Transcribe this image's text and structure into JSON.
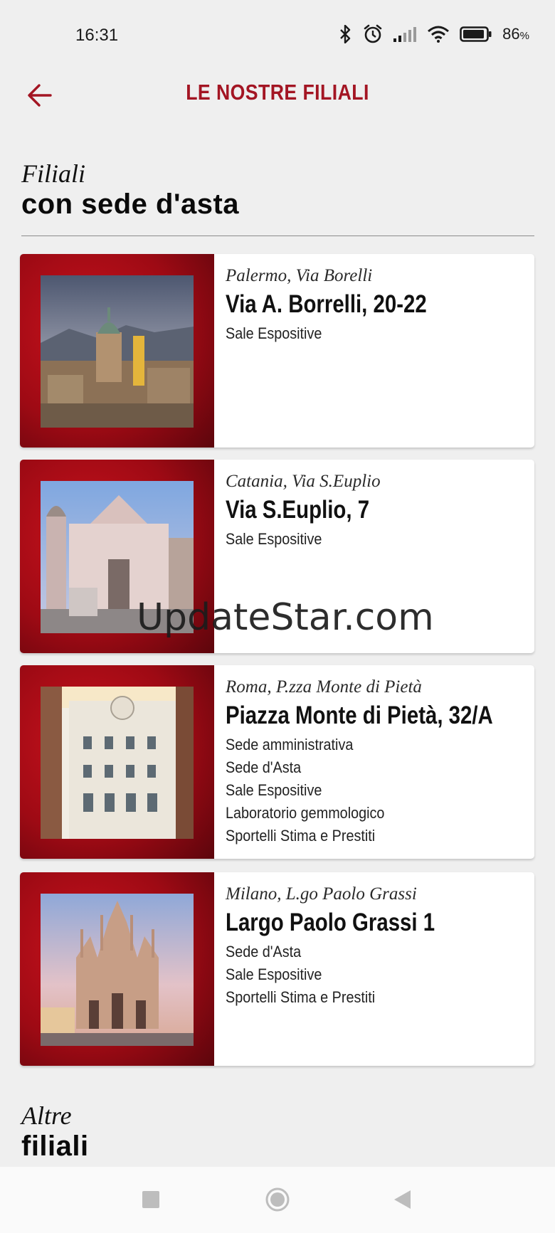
{
  "status_bar": {
    "time": "16:31",
    "battery_percent": "86",
    "battery_unit": "%",
    "icons": [
      "bluetooth-icon",
      "alarm-icon",
      "signal-icon",
      "wifi-icon",
      "battery-icon"
    ]
  },
  "app_bar": {
    "title": "LE NOSTRE FILIALI",
    "back_icon": "arrow-left-icon",
    "accent_color": "#a31523"
  },
  "section_main": {
    "italic": "Filiali",
    "bold": "con sede d'asta"
  },
  "branches": [
    {
      "city": "Palermo, Via Borelli",
      "address": "Via A. Borrelli, 20-22",
      "services": [
        "Sale Espositive"
      ]
    },
    {
      "city": "Catania, Via S.Euplio",
      "address": "Via S.Euplio, 7",
      "services": [
        "Sale Espositive"
      ]
    },
    {
      "city": "Roma, P.zza Monte di Pietà",
      "address": "Piazza Monte di Pietà, 32/A",
      "services": [
        "Sede amministrativa",
        "Sede d'Asta",
        "Sale Espositive",
        "Laboratorio gemmologico",
        "Sportelli Stima e Prestiti"
      ]
    },
    {
      "city": "Milano, L.go Paolo Grassi",
      "address": "Largo Paolo Grassi 1",
      "services": [
        "Sede d'Asta",
        "Sale Espositive",
        "Sportelli Stima e Prestiti"
      ]
    }
  ],
  "section_other": {
    "italic": "Altre",
    "bold": "filiali"
  },
  "watermark": "UpdateStar.com",
  "nav_bar": {
    "icons": [
      "recents-square-icon",
      "home-circle-icon",
      "back-triangle-icon"
    ]
  }
}
